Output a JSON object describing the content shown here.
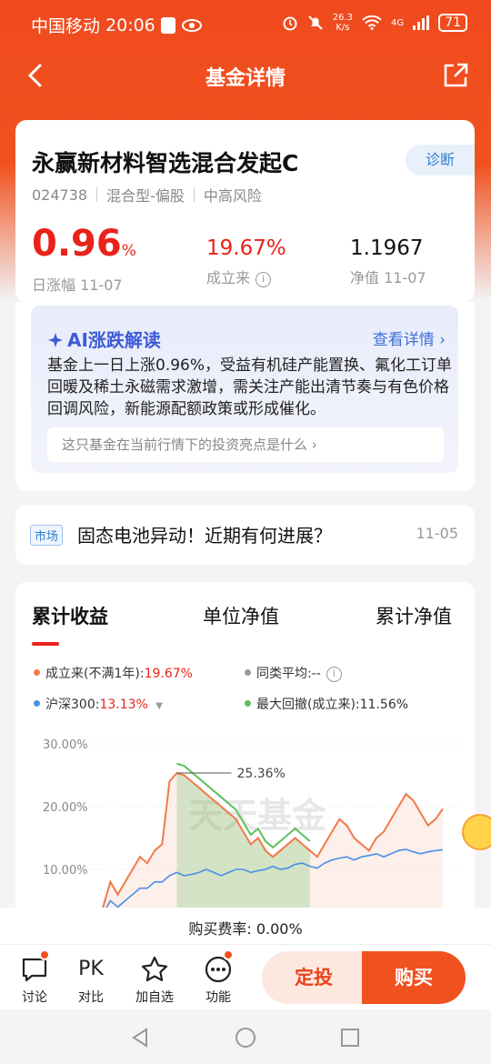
{
  "status_bar": {
    "carrier": "中国移动",
    "time": "20:06",
    "net_speed_top": "26.3",
    "net_speed_bottom": "K/s",
    "signal": "4G",
    "battery": "71"
  },
  "nav": {
    "title": "基金详情"
  },
  "fund": {
    "name": "永赢新材料智选混合发起C",
    "diagnose_label": "诊断",
    "code": "024738",
    "type": "混合型-偏股",
    "risk": "中高风险",
    "daily_change": "0.96",
    "daily_change_unit": "%",
    "daily_change_label": "日涨幅 11-07",
    "since_inception": "19.67%",
    "since_inception_label": "成立来",
    "nav_value": "1.1967",
    "nav_label": "净值 11-07"
  },
  "ai": {
    "title": "AI涨跌解读",
    "more": "查看详情",
    "text": "基金上一日上涨0.96%，受益有机硅产能置换、氟化工订单回暖及稀土永磁需求激增，需关注产能出清节奏与有色价格回调风险，新能源配额政策或形成催化。",
    "question": "这只基金在当前行情下的投资亮点是什么"
  },
  "news": {
    "tag": "市场",
    "title": "固态电池异动！近期有何进展？",
    "date": "11-05"
  },
  "chart_section": {
    "tabs": [
      "累计收益",
      "单位净值",
      "累计净值"
    ],
    "legend": {
      "fund_label": "成立来(不满1年):",
      "fund_value": "19.67%",
      "peer_label": "同类平均:",
      "peer_value": "--",
      "index_label": "沪深300:",
      "index_value": "13.13%",
      "drawdown_label": "最大回撤(成立来):",
      "drawdown_value": "11.56%"
    },
    "watermark": "天天基金",
    "colors": {
      "fund": "#f07a4a",
      "index": "#4a8fe8",
      "peer": "#999999",
      "drawdown": "#5cc05c"
    }
  },
  "chart_data": {
    "type": "line",
    "y_tick_labels": [
      "30.00%",
      "20.00%",
      "10.00%"
    ],
    "ylim": [
      0,
      30
    ],
    "peak_annotation": "25.36%",
    "series": [
      {
        "name": "成立来",
        "values": [
          0,
          1,
          4,
          8,
          6,
          8,
          10,
          12,
          11,
          13,
          14,
          24,
          25.36,
          25,
          24,
          23,
          22,
          21,
          20,
          19,
          18,
          16,
          14,
          15,
          13,
          12,
          13,
          14,
          15,
          14,
          13,
          12,
          14,
          16,
          18,
          17,
          15,
          14,
          13,
          15,
          16,
          18,
          20,
          22,
          21,
          19,
          17,
          18,
          19.67
        ]
      },
      {
        "name": "沪深300",
        "values": [
          0,
          1,
          3,
          5,
          4,
          5,
          6,
          7,
          7,
          8,
          8,
          9,
          9.5,
          9,
          9.2,
          9.5,
          10,
          9.5,
          9,
          9.5,
          10,
          10,
          9.5,
          9.8,
          10,
          10.5,
          10,
          10.2,
          10.8,
          11,
          10.5,
          10.2,
          11,
          11.5,
          11.8,
          12,
          11.5,
          12,
          12.2,
          12.5,
          12,
          12.5,
          13,
          13.2,
          12.8,
          12.5,
          12.8,
          13,
          13.13
        ]
      }
    ]
  },
  "bottom": {
    "fee": "购买费率:  0.00%",
    "actions": [
      "讨论",
      "对比",
      "加自选",
      "功能"
    ],
    "pk_text": "PK",
    "sip_label": "定投",
    "buy_label": "购买"
  }
}
